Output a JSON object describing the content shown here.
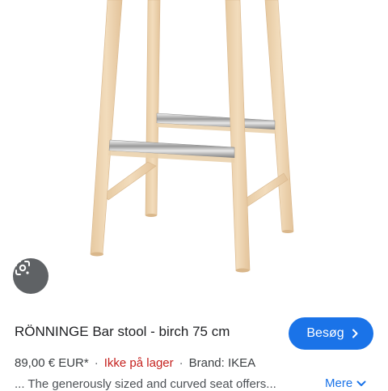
{
  "product": {
    "title": "RÖNNINGE Bar stool - birch 75 cm",
    "price": "89,00 € EUR*",
    "separator": "·",
    "stock_status": "Ikke på lager",
    "brand": "Brand: IKEA",
    "snippet": "... The generously sized and curved seat offers..."
  },
  "actions": {
    "visit_label": "Besøg",
    "more_label": "Mere"
  },
  "icons": {
    "lens": "google-lens-icon",
    "visit_chevron": "chevron-right-icon",
    "more_chevron": "chevron-down-icon"
  },
  "colors": {
    "accent": "#1a73e8",
    "out_of_stock": "#c5221f",
    "wood": "#ead1ad"
  }
}
